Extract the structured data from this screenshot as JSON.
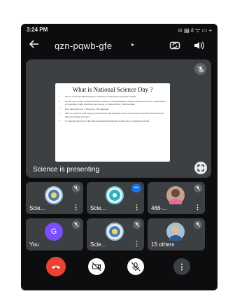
{
  "status": {
    "time": "3:24 PM",
    "icons": "⊙ ▤.ıl ᯤ ▭ +"
  },
  "topbar": {
    "room_code": "qzn-pqwb-gfe",
    "caret": "▸"
  },
  "main": {
    "slide": {
      "title": "What is National Science Day ?",
      "bullets": [
        "We are aware that 28th February is celebrated as National Science Day in India.",
        "On this day in 1928, Celebrated Indian Scientist Sir Chandrashekhara Venkata Raman discovered a phenomenon of scattering of light which was later known as \"Raman Effect\" after his name.",
        "How did he discover ? The story... The questions.",
        "After two years in 1930, he got Nobel Prize for this remarkable discovery and this was the first Nobel Prize for India in the field of Science.",
        "To mark the discovery of his famous phenomenon National Science Day is celebrated in India."
      ]
    },
    "presenting_label": "Science is presenting"
  },
  "tiles": [
    {
      "name": "Scie...",
      "mic": "muted"
    },
    {
      "name": "Scie...",
      "mic": "talking"
    },
    {
      "name": "468-...",
      "mic": "muted"
    },
    {
      "name": "You",
      "avatar_letter": "G",
      "mic": "muted"
    },
    {
      "name": "Scie...",
      "mic": "muted"
    },
    {
      "name": "15 others",
      "mic": "muted"
    }
  ],
  "more_glyph": "⋮",
  "colors": {
    "end_call": "#ea4335",
    "tile_bg": "#3c4043",
    "avatar_you": "#7c4dff",
    "talking": "#1a73e8"
  }
}
